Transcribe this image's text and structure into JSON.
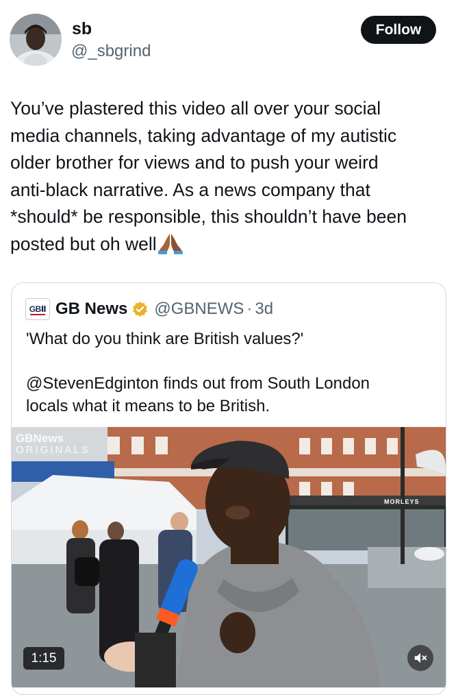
{
  "author": {
    "display_name": "sb",
    "handle": "@_sbgrind",
    "avatar_icon": "user-avatar"
  },
  "follow_button": {
    "label": "Follow"
  },
  "tweet": {
    "text": "You’ve plastered this video all over your social\nmedia channels, taking advantage of my autistic\nolder brother for views and to push your weird\nanti-black narrative. As a news company that\n*should* be responsible, this shouldn’t have been\nposted but oh well",
    "emoji_icon": "folded-hands-icon"
  },
  "quoted_post": {
    "logo_text": "GBⅡ",
    "name": "GB News",
    "verified_icon": "gold-verified-badge-icon",
    "handle": "@GBNEWS",
    "separator": "·",
    "time": "3d",
    "text": "'What do you think are British values?'\n\n@StevenEdginton finds out from South London\nlocals what it means to be British.",
    "video": {
      "watermark_line1": "GBNews",
      "watermark_line2": "ORIGINALS",
      "shop_sign": "MORLEYS",
      "duration": "1:15",
      "mute_icon": "speaker-muted-icon"
    }
  },
  "colors": {
    "text_primary": "#0f1419",
    "text_secondary": "#536471",
    "border": "#cfd9de",
    "follow_bg": "#0f1419",
    "verified_gold": "#e8b22a"
  }
}
